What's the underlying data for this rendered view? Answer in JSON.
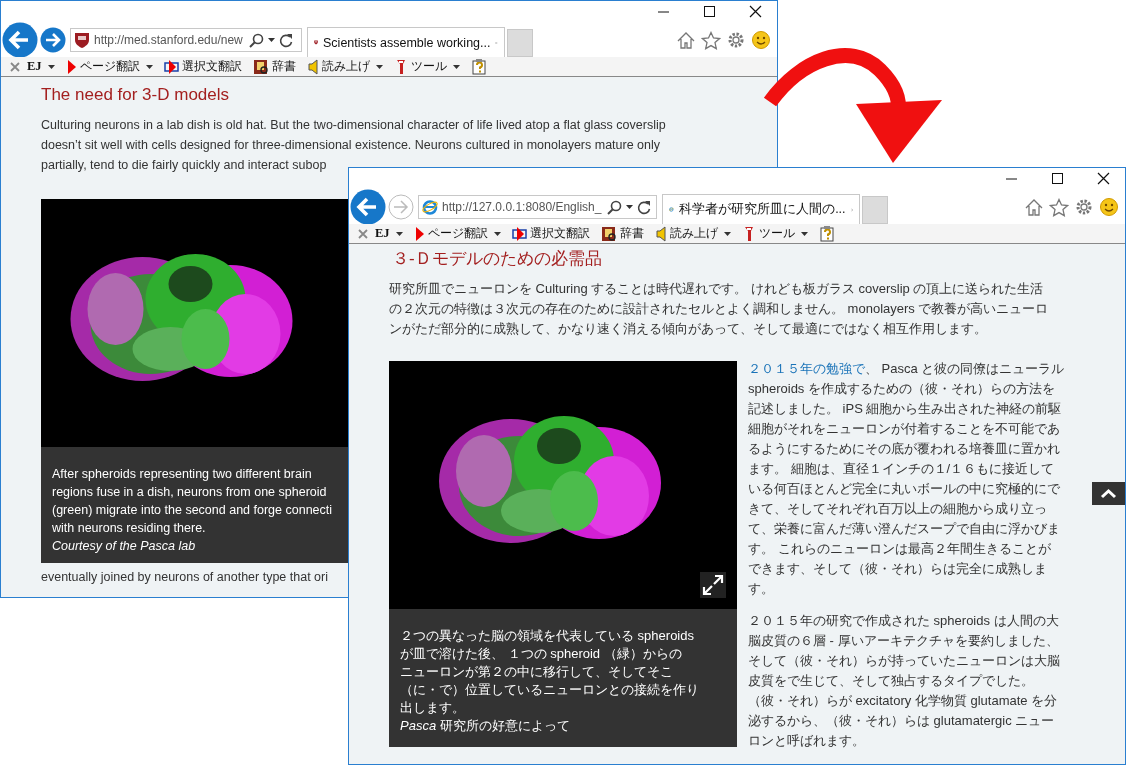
{
  "windows": [
    {
      "forward_enabled": true,
      "favicon": {
        "kind": "shield"
      },
      "address": "http://med.stanford.edu/new",
      "tab_title": "Scientists assemble working...",
      "toolbar": [
        {
          "kind": "ej",
          "label": "EJ",
          "dropdown": true
        },
        {
          "kind": "page",
          "label": "ページ翻訳",
          "dropdown": true
        },
        {
          "kind": "select",
          "label": "選択文翻訳",
          "dropdown": false
        },
        {
          "kind": "dict",
          "label": "辞書",
          "dropdown": false
        },
        {
          "kind": "speak",
          "label": "読み上げ",
          "dropdown": true
        },
        {
          "kind": "tool",
          "label": "ツール",
          "dropdown": true
        },
        {
          "kind": "help",
          "dropdown": false
        }
      ],
      "article": {
        "heading": "The need for 3-D models",
        "intro_lines": [
          "Culturing neurons in a lab dish is old hat. But the two-dimensional character of life lived atop a flat glass coverslip",
          "doesn’t sit well with cells designed for three-dimensional existence. Neurons cultured in monolayers mature only",
          "partially, tend to die fairly quickly and interact subop"
        ],
        "figure": {
          "kind": "picture",
          "expand_button": false,
          "caption_lines": [
            "After spheroids representing two different brain",
            "regions fuse in a dish, neurons from one spheroid",
            "(green) migrate into the second and forge connecti",
            "with neurons residing there."
          ],
          "credit": "Courtesy of the Pasca lab",
          "credit_italic": true
        },
        "after_lines": [
          "eventually joined by neurons of another type that ori"
        ]
      },
      "scroll_top_button": false
    },
    {
      "forward_enabled": false,
      "favicon": {
        "kind": "ie"
      },
      "address": "http://127.0.0.1:8080/English_",
      "tab_title": "科学者が研究所皿に人間の...",
      "toolbar": [
        {
          "kind": "ej",
          "label": "EJ",
          "dropdown": true
        },
        {
          "kind": "page",
          "label": "ページ翻訳",
          "dropdown": true
        },
        {
          "kind": "select",
          "label": "選択文翻訳",
          "dropdown": false
        },
        {
          "kind": "dict",
          "label": "辞書",
          "dropdown": false
        },
        {
          "kind": "speak",
          "label": "読み上げ",
          "dropdown": true
        },
        {
          "kind": "tool",
          "label": "ツール",
          "dropdown": true
        },
        {
          "kind": "help",
          "dropdown": false
        }
      ],
      "article": {
        "heading": "３-Ｄモデルのための必需品",
        "intro_lines": [
          "研究所皿でニューロンを Culturing することは時代遅れです。 けれども板ガラス coverslip の頂上に送られた生活",
          "の２次元の特徴は３次元の存在のために設計されたセルとよく調和しません。 monolayers で教養が高いニューロ",
          "ンがただ部分的に成熟して、かなり速く消える傾向があって、そして最適にではなく相互作用します。"
        ],
        "figure": {
          "kind": "picture",
          "expand_button": true,
          "caption_lines": [
            "２つの異なった脳の領域を代表している spheroids",
            "が皿で溶けた後、 １つの spheroid （緑）からの",
            "ニューロンが第２の中に移行して、そしてそこ",
            "（に・で）位置しているニューロンとの接続を作り",
            "出します。"
          ],
          "credit": "*Pasca* 研究所の好意によって",
          "credit_italic": false
        },
        "side_paragraphs": [
          {
            "link": "２０１５年の勉強で",
            "lines": [
              "、 Pasca と彼の同僚はニューラル",
              "spheroids を作成するための（彼・それ）らの方法を",
              "記述しました。 iPS 細胞から生み出された神経の前駆",
              "細胞がそれをニューロンが付着することを不可能であ",
              "るようにするためにその底が覆われる培養皿に置かれ",
              "ます。 細胞は、直径１インチの１/１６もに接近して",
              "いる何百ほとんど完全に丸いボールの中に究極的にで",
              "きて、そしてそれぞれ百万以上の細胞から成り立っ",
              "て、栄養に富んだ薄い澄んだスープで自由に浮かびま",
              "す。 これらのニューロンは最高２年間生きることが",
              "できます、そして（彼・それ）らは完全に成熟しま",
              "す。"
            ]
          },
          {
            "lines": [
              "２０１５年の研究で作成された spheroids は人間の大",
              "脳皮質の６層 - 厚いアーキテクチャを要約しました、",
              "そして（彼・それ）らが持っていたニューロンは大脳",
              "皮質をで生じて、そして独占するタイプでした。",
              "（彼・それ）らが excitatory 化学物質 glutamate を分",
              "泌するから、（彼・それ）らは glutamatergic ニュー",
              "ロンと呼ばれます。"
            ]
          }
        ]
      },
      "scroll_top_button": true
    }
  ]
}
